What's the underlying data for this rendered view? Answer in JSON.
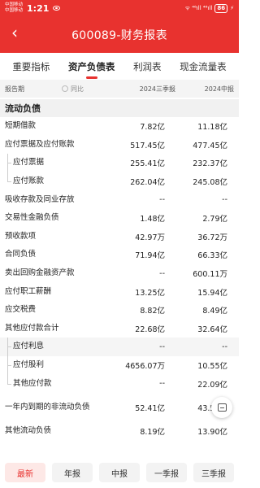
{
  "status": {
    "carrier1": "中国移动",
    "carrier2": "中国移动",
    "time": "1:21",
    "signal": "ᯤ ⁴⁶ıll ⁴⁶ıll",
    "battery": "86"
  },
  "header": {
    "back": "‹",
    "title": "600089-财务报表"
  },
  "tabs": [
    {
      "label": "重要指标"
    },
    {
      "label": "资产负债表"
    },
    {
      "label": "利润表"
    },
    {
      "label": "现金流量表"
    }
  ],
  "columns": {
    "period": "报告期",
    "yoy": "同比",
    "col1": "2024三季报",
    "col2": "2024中报"
  },
  "section": {
    "title": "流动负债"
  },
  "rows": [
    {
      "label": "短期借款",
      "v1": "7.82亿",
      "v2": "11.18亿"
    },
    {
      "label": "应付票据及应付账款",
      "v1": "517.45亿",
      "v2": "477.45亿"
    },
    {
      "label": "应付票据",
      "v1": "255.41亿",
      "v2": "232.37亿"
    },
    {
      "label": "应付账款",
      "v1": "262.04亿",
      "v2": "245.08亿"
    },
    {
      "label": "吸收存款及同业存放",
      "v1": "--",
      "v2": "--"
    },
    {
      "label": "交易性金融负债",
      "v1": "1.48亿",
      "v2": "2.79亿"
    },
    {
      "label": "预收款项",
      "v1": "42.97万",
      "v2": "36.72万"
    },
    {
      "label": "合同负债",
      "v1": "71.94亿",
      "v2": "66.33亿"
    },
    {
      "label": "卖出回购金融资产款",
      "v1": "--",
      "v2": "600.11万"
    },
    {
      "label": "应付职工薪酬",
      "v1": "13.25亿",
      "v2": "15.94亿"
    },
    {
      "label": "应交税费",
      "v1": "8.82亿",
      "v2": "8.49亿"
    },
    {
      "label": "其他应付款合计",
      "v1": "22.68亿",
      "v2": "32.64亿"
    },
    {
      "label": "应付利息",
      "v1": "--",
      "v2": "--"
    },
    {
      "label": "应付股利",
      "v1": "4656.07万",
      "v2": "10.55亿"
    },
    {
      "label": "其他应付款",
      "v1": "--",
      "v2": "22.09亿"
    },
    {
      "label": "一年内到期的非流动负债",
      "v1": "52.41亿",
      "v2": "43.50亿"
    },
    {
      "label": "其他流动负债",
      "v1": "8.19亿",
      "v2": "13.90亿"
    }
  ],
  "bottom": [
    {
      "label": "最新"
    },
    {
      "label": "年报"
    },
    {
      "label": "中报"
    },
    {
      "label": "一季报"
    },
    {
      "label": "三季报"
    }
  ],
  "colors": {
    "accent": "#e8322f"
  }
}
